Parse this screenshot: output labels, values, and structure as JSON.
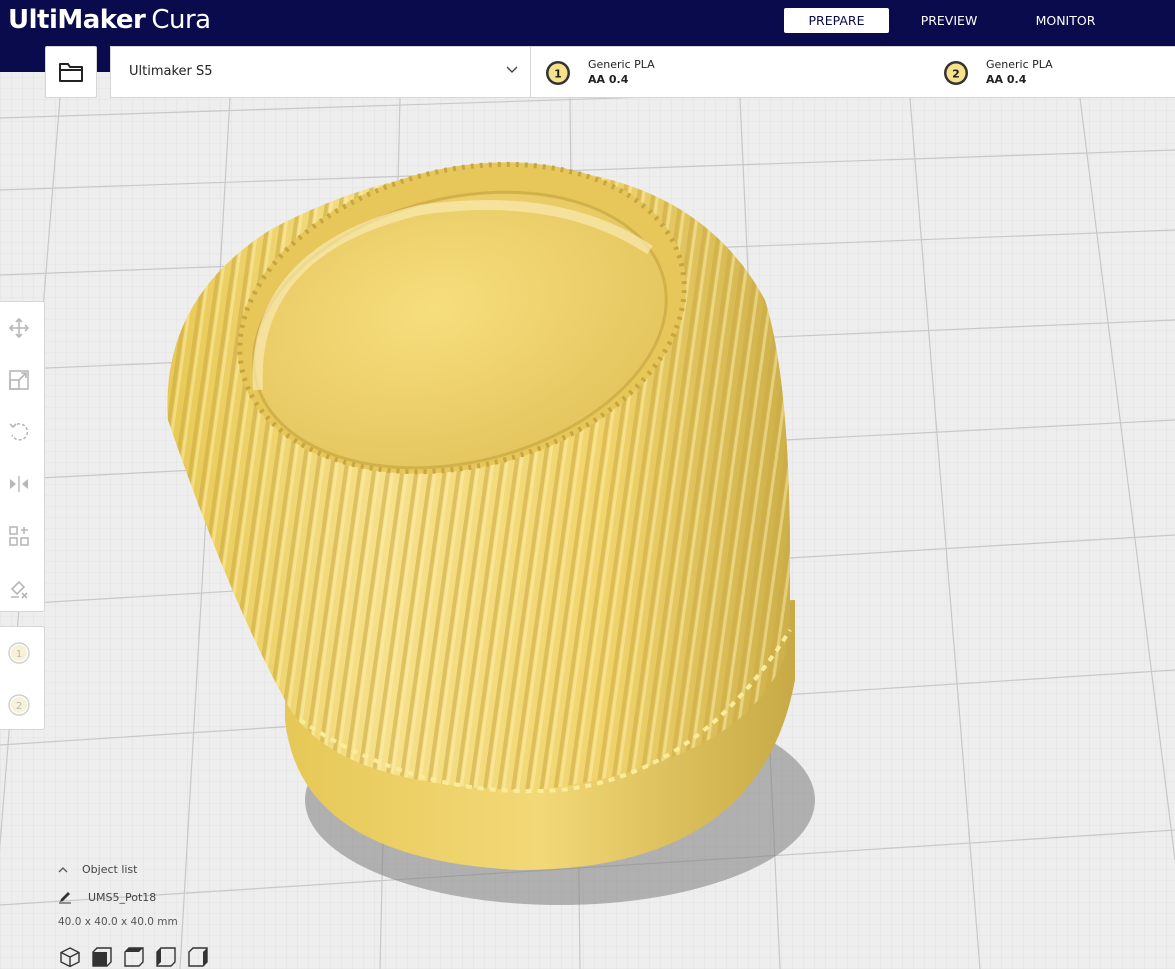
{
  "app": {
    "brand": "UltiMaker",
    "product": "Cura"
  },
  "stage_tabs": [
    {
      "label": "PREPARE",
      "active": true
    },
    {
      "label": "PREVIEW",
      "active": false
    },
    {
      "label": "MONITOR",
      "active": false
    }
  ],
  "toolbar": {
    "open_icon": "folder-icon",
    "printer": "Ultimaker S5",
    "extruders": [
      {
        "number": "1",
        "material": "Generic PLA",
        "core": "AA 0.4"
      },
      {
        "number": "2",
        "material": "Generic PLA",
        "core": "AA 0.4"
      }
    ]
  },
  "tools": [
    "move-icon",
    "scale-icon",
    "rotate-icon",
    "mirror-icon",
    "per-model-settings-icon",
    "support-blocker-icon"
  ],
  "extruder_tools": [
    "1",
    "2"
  ],
  "object_list": {
    "title": "Object list",
    "object_name": "UMS5_Pot18",
    "dimensions": "40.0 x 40.0 x 40.0 mm"
  },
  "view_buttons": [
    "3d-view-icon",
    "front-view-icon",
    "top-view-icon",
    "left-view-icon",
    "right-view-icon"
  ],
  "colors": {
    "header": "#0a0b4c",
    "model": "#f2d56b",
    "model_shadow": "#b9a04a",
    "grid_bg": "#eeeeee"
  }
}
